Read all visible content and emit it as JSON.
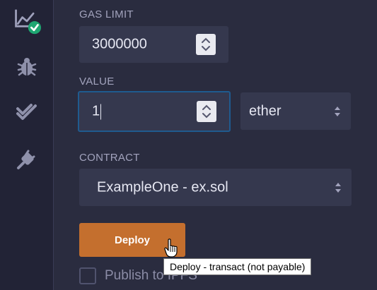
{
  "sidebar": {
    "icons": [
      {
        "name": "deploy-run-icon"
      },
      {
        "name": "debugger-icon"
      },
      {
        "name": "testing-icon"
      },
      {
        "name": "plugin-icon"
      }
    ]
  },
  "gas_limit": {
    "label": "GAS LIMIT",
    "value": "3000000"
  },
  "value": {
    "label": "VALUE",
    "amount": "1",
    "unit": "ether"
  },
  "contract": {
    "label": "CONTRACT",
    "selected": "ExampleOne - ex.sol"
  },
  "deploy": {
    "label": "Deploy",
    "tooltip": "Deploy - transact (not payable)"
  },
  "publish": {
    "label": "Publish to IPFS"
  },
  "colors": {
    "accent": "#c46f2e",
    "success": "#1ea672",
    "focus": "#1f5b8f"
  }
}
